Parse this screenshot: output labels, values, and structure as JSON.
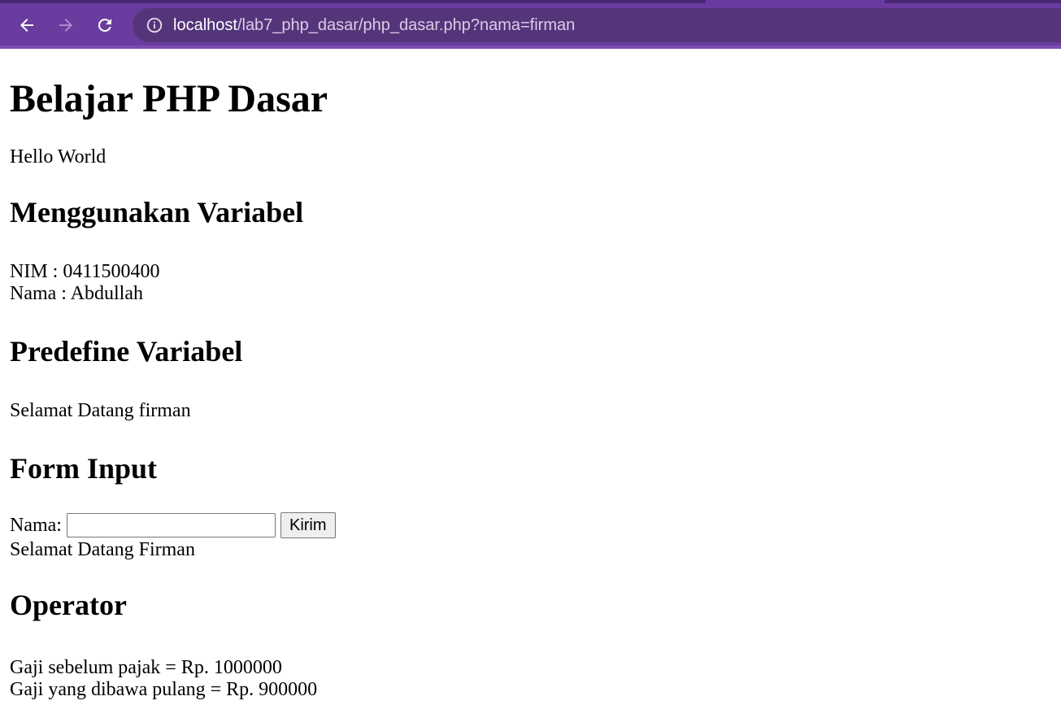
{
  "browser": {
    "url_host": "localhost",
    "url_path": "/lab7_php_dasar/php_dasar.php?nama=firman",
    "icons": [
      "back-arrow-icon",
      "forward-arrow-icon",
      "reload-icon",
      "info-icon"
    ],
    "colors": {
      "toolbar": "#6a3c9f",
      "address_bar": "#55357a",
      "url_host": "#ffffff",
      "url_path": "#d9cde8"
    }
  },
  "page": {
    "title": "Belajar PHP Dasar",
    "hello": "Hello World",
    "section_variabel": {
      "heading": "Menggunakan Variabel",
      "nim": "NIM : 0411500400",
      "nama": "Nama : Abdullah"
    },
    "section_predefine": {
      "heading": "Predefine Variabel",
      "greeting": "Selamat Datang firman"
    },
    "section_form": {
      "heading": "Form Input",
      "label": "Nama:",
      "input_value": "",
      "button_label": "Kirim",
      "result": "Selamat Datang Firman"
    },
    "section_operator": {
      "heading": "Operator",
      "gaji_sebelum": "Gaji sebelum pajak = Rp. 1000000",
      "gaji_pulang": "Gaji yang dibawa pulang = Rp. 900000"
    }
  }
}
